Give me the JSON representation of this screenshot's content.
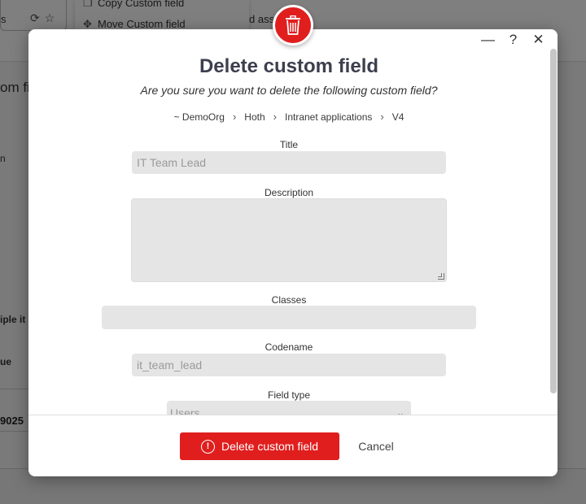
{
  "background": {
    "tab_text": "s",
    "menu_items": [
      {
        "icon": "copy-icon",
        "label": "Copy Custom field"
      },
      {
        "icon": "move-icon",
        "label": "Move Custom field"
      }
    ],
    "assign_fragment": "d assi",
    "heading_fragment": "om fi",
    "label_1": "n",
    "label_2": "iple it",
    "label_3": "ue",
    "value_fragment": "9025"
  },
  "dialog": {
    "title": "Delete custom field",
    "subtitle": "Are you sure you want to delete the following custom field?",
    "breadcrumb": [
      "~ DemoOrg",
      "Hoth",
      "Intranet applications",
      "V4"
    ],
    "breadcrumb_separator": "›",
    "window_controls": {
      "minimize": "—",
      "help": "?",
      "close": "✕"
    },
    "fields": {
      "title": {
        "label": "Title",
        "value": "IT Team Lead"
      },
      "description": {
        "label": "Description",
        "value": ""
      },
      "classes": {
        "label": "Classes",
        "value": ""
      },
      "codename": {
        "label": "Codename",
        "value": "it_team_lead"
      },
      "field_type": {
        "label": "Field type",
        "value": "Users"
      }
    },
    "actions": {
      "delete_label": "Delete custom field",
      "cancel_label": "Cancel"
    }
  },
  "colors": {
    "danger": "#e01e1e",
    "title_text": "#3d3f4e",
    "input_bg": "#e5e5e5"
  }
}
